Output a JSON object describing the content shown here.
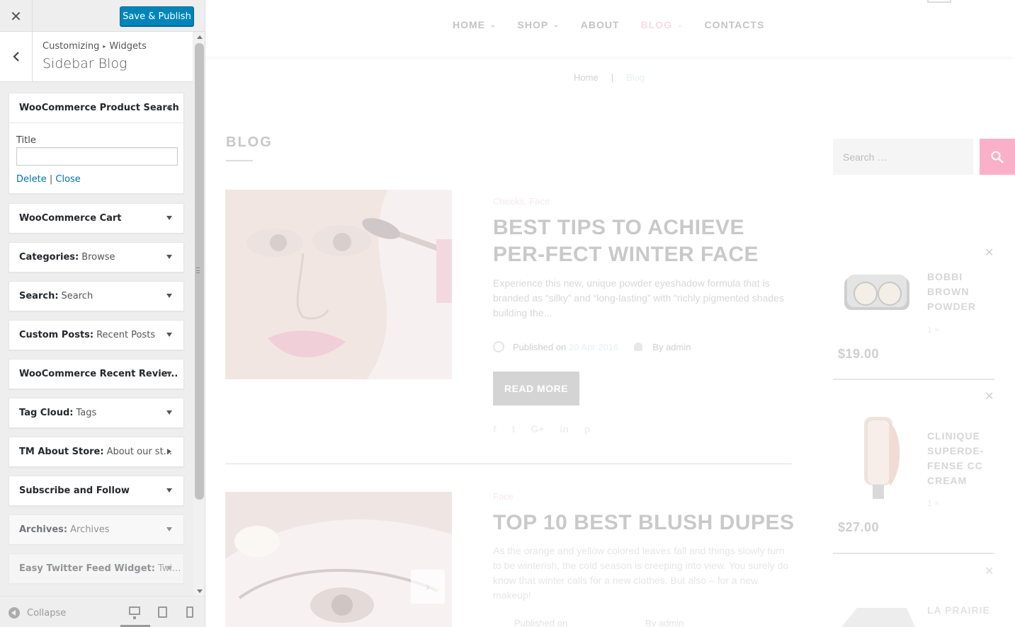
{
  "customizer": {
    "publish_label": "Save & Publish",
    "breadcrumb_root": "Customizing",
    "breadcrumb_section": "Widgets",
    "panel_title": "Sidebar Blog",
    "expanded_widget": {
      "name": "WooCommerce Product Search",
      "title_label": "Title",
      "title_value": "",
      "delete_label": "Delete",
      "close_label": "Close"
    },
    "widgets": [
      {
        "name": "WooCommerce Cart",
        "title": ""
      },
      {
        "name": "Categories:",
        "title": "Browse"
      },
      {
        "name": "Search:",
        "title": "Search"
      },
      {
        "name": "Custom Posts:",
        "title": "Recent Posts"
      },
      {
        "name": "WooCommerce Recent Revie...",
        "title": ""
      },
      {
        "name": "Tag Cloud:",
        "title": "Tags"
      },
      {
        "name": "TM About Store:",
        "title": "About our st..."
      },
      {
        "name": "Subscribe and Follow",
        "title": ""
      },
      {
        "name": "Archives:",
        "title": "Archives"
      },
      {
        "name": "Easy Twitter Feed Widget:",
        "title": "Twi..."
      }
    ],
    "collapse_label": "Collapse"
  },
  "preview": {
    "nav": [
      {
        "label": "HOME",
        "has_caret": true
      },
      {
        "label": "SHOP",
        "has_caret": true
      },
      {
        "label": "ABOUT",
        "has_caret": false
      },
      {
        "label": "BLOG",
        "has_caret": true,
        "active": true
      },
      {
        "label": "CONTACTS",
        "has_caret": false
      }
    ],
    "breadcrumbs": {
      "home": "Home",
      "separator": "|",
      "current": "Blog"
    },
    "page_heading": "BLOG",
    "posts": [
      {
        "categories": "Cheeks, Face",
        "title": "BEST TIPS TO ACHIEVE PER-FECT WINTER FACE",
        "excerpt": "Experience this new, unique powder eyeshadow formula that is branded as “silky” and “long-lasting” with “richly pigmented shades building the...",
        "published_prefix": "Published on",
        "date": "20 Apr 2016",
        "author": "By admin",
        "read_more": "READ MORE",
        "share": [
          "f",
          "t",
          "G+",
          "in",
          "p"
        ]
      },
      {
        "categories": "Face",
        "title": "TOP 10 BEST BLUSH DUPES",
        "excerpt": "As the orange and yellow colored leaves fall and things slowly turn to be winterish, the cold season is creeping into view. You surely do know that winter calls for a new clothes. But also – for a new makeup!",
        "published_prefix": "Published on",
        "author": "By admin"
      }
    ],
    "search_placeholder": "Search …",
    "cart_items": [
      {
        "name": "BOBBI BROWN POWDER",
        "qty": "1 ×",
        "price": "$19.00"
      },
      {
        "name": "CLINIQUE SUPERDE-FENSE CC CREAM",
        "qty": "1 ×",
        "price": "$27.00"
      },
      {
        "name": "LA PRAIRIE",
        "qty": "",
        "price": ""
      }
    ],
    "colors": {
      "accent_pink": "#fbb0c9",
      "wp_blue": "#0085ba"
    }
  }
}
